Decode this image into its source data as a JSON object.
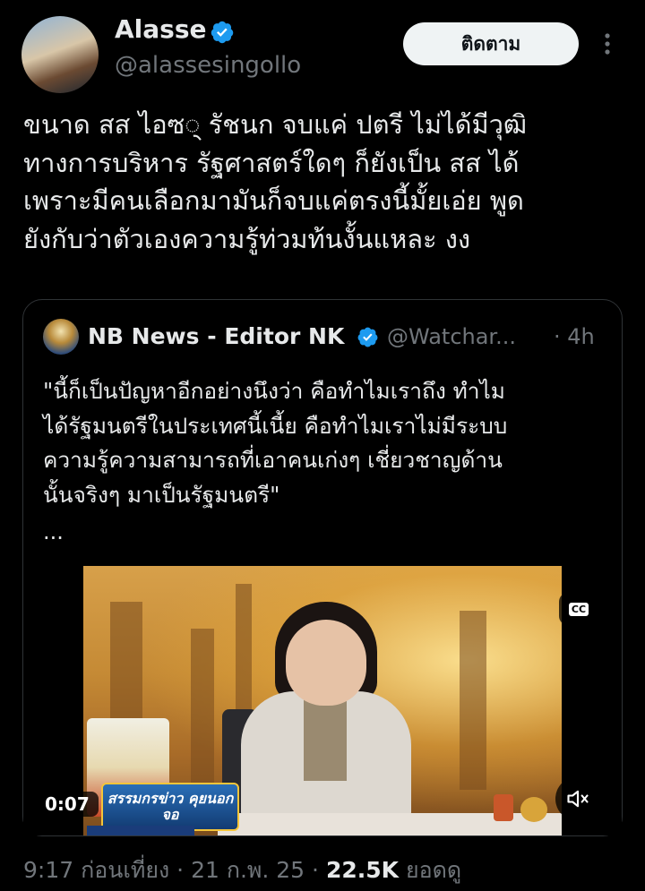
{
  "author": {
    "display_name": "Alasse",
    "handle": "@alassesingollo",
    "verified": true
  },
  "follow_label": "ติดตาม",
  "tweet_text": "ขนาด สส ไอซ् รัชนก จบแค่ ปตรี ไม่ได้มีวุฒิ\nทางการบริหาร รัฐศาสตร์ใดๆ ก็ยังเป็น สส ได้\nเพราะมีคนเลือกมามันก็จบแค่ตรงนี้มั้ยเอ่ย พูด\nยังกับว่าตัวเองความรู้ท่วมท้นงั้นแหละ งง",
  "quote": {
    "display_name": "NB News - Editor NK",
    "handle": "@Watchar...",
    "time": "· 4h",
    "verified": true,
    "text": "\"นี้ก็เป็นปัญหาอีกอย่างนึงว่า คือทำไมเราถึง ทำไม\nได้รัฐมนตรีในประเทศนี้เนี้ย คือทำไมเราไม่มีระบบ\nความรู้ความสามารถที่เอาคนเก่งๆ เชี่ยวชาญด้าน\nนั้นจริงๆ มาเป็นรัฐมนตรี\"",
    "ellipsis": "...",
    "video": {
      "timer": "0:07",
      "cc_label": "CC",
      "banner_text": "สรรมกรข่าว คุยนอกจอ"
    }
  },
  "meta": {
    "time": "9:17 ก่อนเที่ยง",
    "sep1": " · ",
    "date": "21 ก.พ. 25",
    "sep2": " · ",
    "views": "22.5K",
    "views_label": " ยอดดู"
  },
  "colors": {
    "background": "#000000",
    "text": "#e7e9ea",
    "muted": "#71767b",
    "verified": "#1d9bf0",
    "border": "#2f3336"
  }
}
